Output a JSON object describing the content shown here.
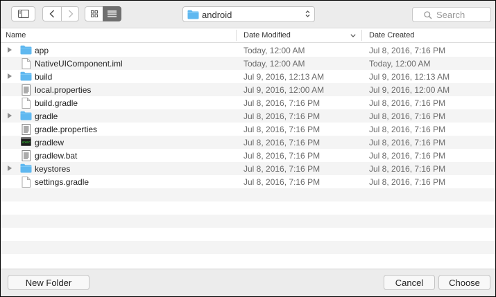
{
  "toolbar": {
    "path_label": "android",
    "search_placeholder": "Search"
  },
  "columns": {
    "name": "Name",
    "date_modified": "Date Modified",
    "date_created": "Date Created"
  },
  "files": [
    {
      "name": "app",
      "type": "folder",
      "modified": "Today, 12:00 AM",
      "created": "Jul 8, 2016, 7:16 PM"
    },
    {
      "name": "NativeUIComponent.iml",
      "type": "document",
      "modified": "Today, 12:00 AM",
      "created": "Today, 12:00 AM"
    },
    {
      "name": "build",
      "type": "folder",
      "modified": "Jul 9, 2016, 12:13 AM",
      "created": "Jul 9, 2016, 12:13 AM"
    },
    {
      "name": "local.properties",
      "type": "text-document",
      "modified": "Jul 9, 2016, 12:00 AM",
      "created": "Jul 9, 2016, 12:00 AM"
    },
    {
      "name": "build.gradle",
      "type": "document",
      "modified": "Jul 8, 2016, 7:16 PM",
      "created": "Jul 8, 2016, 7:16 PM"
    },
    {
      "name": "gradle",
      "type": "folder",
      "modified": "Jul 8, 2016, 7:16 PM",
      "created": "Jul 8, 2016, 7:16 PM"
    },
    {
      "name": "gradle.properties",
      "type": "text-document",
      "modified": "Jul 8, 2016, 7:16 PM",
      "created": "Jul 8, 2016, 7:16 PM"
    },
    {
      "name": "gradlew",
      "type": "executable",
      "modified": "Jul 8, 2016, 7:16 PM",
      "created": "Jul 8, 2016, 7:16 PM"
    },
    {
      "name": "gradlew.bat",
      "type": "text-document",
      "modified": "Jul 8, 2016, 7:16 PM",
      "created": "Jul 8, 2016, 7:16 PM"
    },
    {
      "name": "keystores",
      "type": "folder",
      "modified": "Jul 8, 2016, 7:16 PM",
      "created": "Jul 8, 2016, 7:16 PM"
    },
    {
      "name": "settings.gradle",
      "type": "document",
      "modified": "Jul 8, 2016, 7:16 PM",
      "created": "Jul 8, 2016, 7:16 PM"
    }
  ],
  "buttons": {
    "new_folder": "New Folder",
    "cancel": "Cancel",
    "choose": "Choose"
  },
  "colors": {
    "folder": "#5fb8f0",
    "folder_tab": "#7dc8f5",
    "window_bg": "#ececec",
    "row_alt": "#f4f4f4"
  }
}
